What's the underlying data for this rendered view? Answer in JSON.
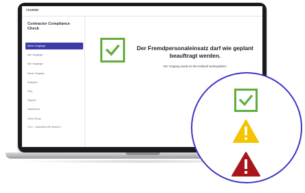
{
  "app": {
    "brand": "/AGENK",
    "title": "Contractor Compliance Check"
  },
  "sidebar": {
    "items": [
      {
        "label": "Meine Vorgänge",
        "active": true
      },
      {
        "label": "Alle Vorgänge",
        "active": false
      },
      {
        "label": "Alle Vorgänge",
        "active": false
      },
      {
        "label": "Neuer Vorgang",
        "active": false
      },
      {
        "label": "Analytics",
        "active": false
      },
      {
        "label": "FAQ",
        "active": false
      },
      {
        "label": "Support",
        "active": false
      },
      {
        "label": "Impressum",
        "active": false
      },
      {
        "label": "Client Setup",
        "active": false
      },
      {
        "label": "CCC – EasyWire.DB Version 2",
        "active": false
      }
    ]
  },
  "main": {
    "status_icon": "check-icon",
    "message_title": "Der Fremdpersonaleinsatz darf wie geplant beauftragt werden.",
    "message_subtitle": "Der Vorgang wurde an den Einkauf weitergeleitet."
  },
  "legend": {
    "icons": [
      "check-icon",
      "warning-icon",
      "danger-icon"
    ]
  },
  "colors": {
    "accent": "#3e3aa8",
    "success": "#5fae3c",
    "warning": "#f5c400",
    "danger": "#a8161c",
    "circle_border": "#3d35c4"
  }
}
